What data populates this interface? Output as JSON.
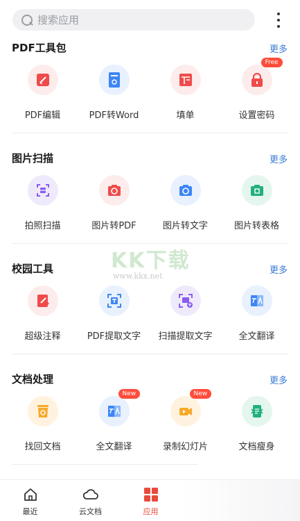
{
  "search": {
    "placeholder": "搜索应用"
  },
  "sections": [
    {
      "title": "PDF工具包",
      "more": "更多",
      "tools": [
        {
          "label": "PDF编辑",
          "icon": "pdf-edit-icon",
          "badge": ""
        },
        {
          "label": "PDF转Word",
          "icon": "pdf-to-word-icon",
          "badge": ""
        },
        {
          "label": "填单",
          "icon": "fill-form-icon",
          "badge": ""
        },
        {
          "label": "设置密码",
          "icon": "lock-icon",
          "badge": "Free"
        }
      ]
    },
    {
      "title": "图片扫描",
      "more": "更多",
      "tools": [
        {
          "label": "拍照扫描",
          "icon": "photo-scan-icon",
          "badge": ""
        },
        {
          "label": "图片转PDF",
          "icon": "image-to-pdf-icon",
          "badge": ""
        },
        {
          "label": "图片转文字",
          "icon": "image-to-text-icon",
          "badge": ""
        },
        {
          "label": "图片转表格",
          "icon": "image-to-table-icon",
          "badge": ""
        }
      ]
    },
    {
      "title": "校园工具",
      "more": "更多",
      "tools": [
        {
          "label": "超级注释",
          "icon": "annotate-icon",
          "badge": ""
        },
        {
          "label": "PDF提取文字",
          "icon": "pdf-extract-text-icon",
          "badge": ""
        },
        {
          "label": "扫描提取文字",
          "icon": "scan-extract-text-icon",
          "badge": ""
        },
        {
          "label": "全文翻译",
          "icon": "translate-icon",
          "badge": ""
        }
      ]
    },
    {
      "title": "文档处理",
      "more": "更多",
      "tools": [
        {
          "label": "找回文档",
          "icon": "recover-document-icon",
          "badge": ""
        },
        {
          "label": "全文翻译",
          "icon": "translate-icon",
          "badge": "New"
        },
        {
          "label": "录制幻灯片",
          "icon": "record-slides-icon",
          "badge": "New"
        },
        {
          "label": "文档瘦身",
          "icon": "slim-document-icon",
          "badge": ""
        }
      ]
    }
  ],
  "watermark": {
    "main": "KK下载",
    "sub": "www.kkx.net"
  },
  "tabs": [
    {
      "label": "最近",
      "icon": "home-icon"
    },
    {
      "label": "云文档",
      "icon": "cloud-icon"
    },
    {
      "label": "应用",
      "icon": "apps-grid-icon",
      "active": true
    }
  ],
  "colors": {
    "accent": "#e84b3c",
    "link": "#3a7bd5",
    "badge": "#ff4d3a"
  }
}
